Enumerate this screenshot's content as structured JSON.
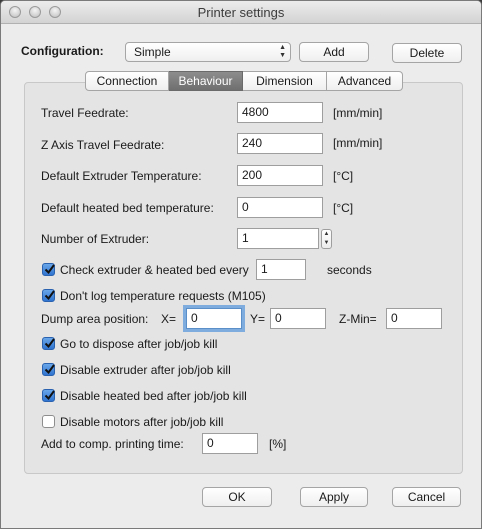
{
  "window": {
    "title": "Printer settings"
  },
  "config": {
    "label": "Configuration:",
    "selected": "Simple",
    "add_label": "Add",
    "delete_label": "Delete"
  },
  "tabs": [
    {
      "label": "Connection",
      "active": false
    },
    {
      "label": "Behaviour",
      "active": true
    },
    {
      "label": "Dimension",
      "active": false
    },
    {
      "label": "Advanced",
      "active": false
    }
  ],
  "behaviour": {
    "travel_feedrate": {
      "label": "Travel Feedrate:",
      "value": "4800",
      "unit": "[mm/min]"
    },
    "z_travel_feedrate": {
      "label": "Z Axis Travel Feedrate:",
      "value": "240",
      "unit": "[mm/min]"
    },
    "extruder_temp": {
      "label": "Default Extruder Temperature:",
      "value": "200",
      "unit": "[°C]"
    },
    "bed_temp": {
      "label": "Default heated bed temperature:",
      "value": "0",
      "unit": "[°C]"
    },
    "num_extruder": {
      "label": "Number of Extruder:",
      "value": "1"
    },
    "check_temp": {
      "label": "Check extruder & heated bed every",
      "value": "1",
      "unit": "seconds",
      "checked": true
    },
    "dont_log": {
      "label": "Don't log temperature requests (M105)",
      "checked": true
    },
    "dump": {
      "label": "Dump area position:",
      "x_label": "X=",
      "x": "0",
      "y_label": "Y=",
      "y": "0",
      "zmin_label": "Z-Min=",
      "zmin": "0"
    },
    "go_dispose": {
      "label": "Go to dispose after job/job kill",
      "checked": true
    },
    "disable_extruder": {
      "label": "Disable extruder after job/job kill",
      "checked": true
    },
    "disable_bed": {
      "label": "Disable heated bed after job/job kill",
      "checked": true
    },
    "disable_motors": {
      "label": "Disable motors after job/job kill",
      "checked": false
    },
    "add_time": {
      "label": "Add to comp. printing time:",
      "value": "0",
      "unit": "[%]"
    }
  },
  "footer": {
    "ok_label": "OK",
    "apply_label": "Apply",
    "cancel_label": "Cancel"
  }
}
